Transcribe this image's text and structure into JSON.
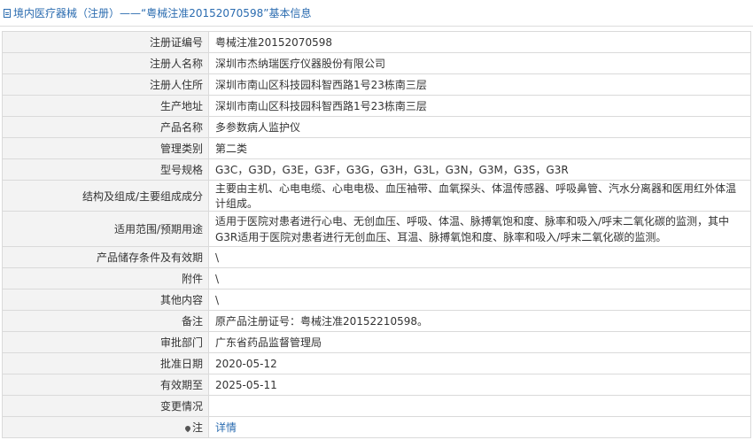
{
  "header": {
    "section": "境内医疗器械（注册）",
    "separator": "——",
    "cert": "“粤械注准20152070598”",
    "suffix": "基本信息"
  },
  "rows": [
    {
      "label": "注册证编号",
      "value": "粤械注准20152070598"
    },
    {
      "label": "注册人名称",
      "value": "深圳市杰纳瑞医疗仪器股份有限公司"
    },
    {
      "label": "注册人住所",
      "value": "深圳市南山区科技园科智西路1号23栋南三层"
    },
    {
      "label": "生产地址",
      "value": "深圳市南山区科技园科智西路1号23栋南三层"
    },
    {
      "label": "产品名称",
      "value": "多参数病人监护仪"
    },
    {
      "label": "管理类别",
      "value": "第二类"
    },
    {
      "label": "型号规格",
      "value": "G3C，G3D，G3E，G3F，G3G，G3H，G3L，G3N，G3M，G3S，G3R"
    },
    {
      "label": "结构及组成/主要组成成分",
      "value": "主要由主机、心电电缆、心电电极、血压袖带、血氧探头、体温传感器、呼吸鼻管、汽水分离器和医用红外体温计组成。"
    },
    {
      "label": "适用范围/预期用途",
      "value": "适用于医院对患者进行心电、无创血压、呼吸、体温、脉搏氧饱和度、脉率和吸入/呼末二氧化碳的监测，其中G3R适用于医院对患者进行无创血压、耳温、脉搏氧饱和度、脉率和吸入/呼末二氧化碳的监测。"
    },
    {
      "label": "产品储存条件及有效期",
      "value": "\\"
    },
    {
      "label": "附件",
      "value": "\\"
    },
    {
      "label": "其他内容",
      "value": "\\"
    },
    {
      "label": "备注",
      "value": "原产品注册证号：粤械注准20152210598。"
    },
    {
      "label": "审批部门",
      "value": "广东省药品监督管理局"
    },
    {
      "label": "批准日期",
      "value": "2020-05-12"
    },
    {
      "label": "有效期至",
      "value": "2025-05-11"
    },
    {
      "label": "变更情况",
      "value": ""
    }
  ],
  "note": {
    "label": "注",
    "link": "详情",
    "icon": "pin-icon"
  }
}
